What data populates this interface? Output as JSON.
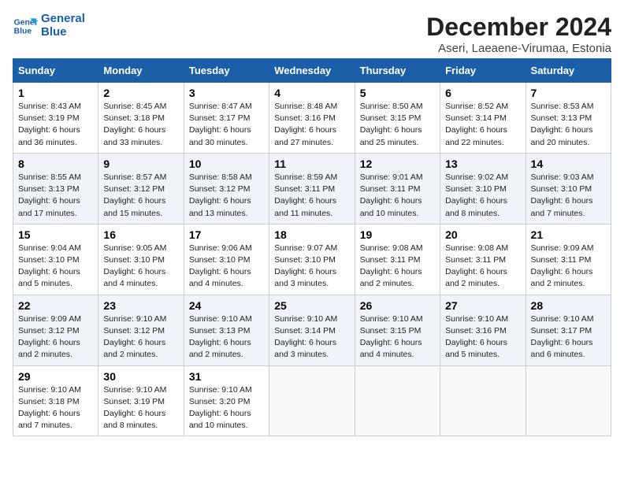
{
  "logo": {
    "line1": "General",
    "line2": "Blue"
  },
  "title": "December 2024",
  "subtitle": "Aseri, Laeaene-Virumaa, Estonia",
  "days_of_week": [
    "Sunday",
    "Monday",
    "Tuesday",
    "Wednesday",
    "Thursday",
    "Friday",
    "Saturday"
  ],
  "weeks": [
    [
      {
        "day": "1",
        "sunrise": "Sunrise: 8:43 AM",
        "sunset": "Sunset: 3:19 PM",
        "daylight": "Daylight: 6 hours and 36 minutes."
      },
      {
        "day": "2",
        "sunrise": "Sunrise: 8:45 AM",
        "sunset": "Sunset: 3:18 PM",
        "daylight": "Daylight: 6 hours and 33 minutes."
      },
      {
        "day": "3",
        "sunrise": "Sunrise: 8:47 AM",
        "sunset": "Sunset: 3:17 PM",
        "daylight": "Daylight: 6 hours and 30 minutes."
      },
      {
        "day": "4",
        "sunrise": "Sunrise: 8:48 AM",
        "sunset": "Sunset: 3:16 PM",
        "daylight": "Daylight: 6 hours and 27 minutes."
      },
      {
        "day": "5",
        "sunrise": "Sunrise: 8:50 AM",
        "sunset": "Sunset: 3:15 PM",
        "daylight": "Daylight: 6 hours and 25 minutes."
      },
      {
        "day": "6",
        "sunrise": "Sunrise: 8:52 AM",
        "sunset": "Sunset: 3:14 PM",
        "daylight": "Daylight: 6 hours and 22 minutes."
      },
      {
        "day": "7",
        "sunrise": "Sunrise: 8:53 AM",
        "sunset": "Sunset: 3:13 PM",
        "daylight": "Daylight: 6 hours and 20 minutes."
      }
    ],
    [
      {
        "day": "8",
        "sunrise": "Sunrise: 8:55 AM",
        "sunset": "Sunset: 3:13 PM",
        "daylight": "Daylight: 6 hours and 17 minutes."
      },
      {
        "day": "9",
        "sunrise": "Sunrise: 8:57 AM",
        "sunset": "Sunset: 3:12 PM",
        "daylight": "Daylight: 6 hours and 15 minutes."
      },
      {
        "day": "10",
        "sunrise": "Sunrise: 8:58 AM",
        "sunset": "Sunset: 3:12 PM",
        "daylight": "Daylight: 6 hours and 13 minutes."
      },
      {
        "day": "11",
        "sunrise": "Sunrise: 8:59 AM",
        "sunset": "Sunset: 3:11 PM",
        "daylight": "Daylight: 6 hours and 11 minutes."
      },
      {
        "day": "12",
        "sunrise": "Sunrise: 9:01 AM",
        "sunset": "Sunset: 3:11 PM",
        "daylight": "Daylight: 6 hours and 10 minutes."
      },
      {
        "day": "13",
        "sunrise": "Sunrise: 9:02 AM",
        "sunset": "Sunset: 3:10 PM",
        "daylight": "Daylight: 6 hours and 8 minutes."
      },
      {
        "day": "14",
        "sunrise": "Sunrise: 9:03 AM",
        "sunset": "Sunset: 3:10 PM",
        "daylight": "Daylight: 6 hours and 7 minutes."
      }
    ],
    [
      {
        "day": "15",
        "sunrise": "Sunrise: 9:04 AM",
        "sunset": "Sunset: 3:10 PM",
        "daylight": "Daylight: 6 hours and 5 minutes."
      },
      {
        "day": "16",
        "sunrise": "Sunrise: 9:05 AM",
        "sunset": "Sunset: 3:10 PM",
        "daylight": "Daylight: 6 hours and 4 minutes."
      },
      {
        "day": "17",
        "sunrise": "Sunrise: 9:06 AM",
        "sunset": "Sunset: 3:10 PM",
        "daylight": "Daylight: 6 hours and 4 minutes."
      },
      {
        "day": "18",
        "sunrise": "Sunrise: 9:07 AM",
        "sunset": "Sunset: 3:10 PM",
        "daylight": "Daylight: 6 hours and 3 minutes."
      },
      {
        "day": "19",
        "sunrise": "Sunrise: 9:08 AM",
        "sunset": "Sunset: 3:11 PM",
        "daylight": "Daylight: 6 hours and 2 minutes."
      },
      {
        "day": "20",
        "sunrise": "Sunrise: 9:08 AM",
        "sunset": "Sunset: 3:11 PM",
        "daylight": "Daylight: 6 hours and 2 minutes."
      },
      {
        "day": "21",
        "sunrise": "Sunrise: 9:09 AM",
        "sunset": "Sunset: 3:11 PM",
        "daylight": "Daylight: 6 hours and 2 minutes."
      }
    ],
    [
      {
        "day": "22",
        "sunrise": "Sunrise: 9:09 AM",
        "sunset": "Sunset: 3:12 PM",
        "daylight": "Daylight: 6 hours and 2 minutes."
      },
      {
        "day": "23",
        "sunrise": "Sunrise: 9:10 AM",
        "sunset": "Sunset: 3:12 PM",
        "daylight": "Daylight: 6 hours and 2 minutes."
      },
      {
        "day": "24",
        "sunrise": "Sunrise: 9:10 AM",
        "sunset": "Sunset: 3:13 PM",
        "daylight": "Daylight: 6 hours and 2 minutes."
      },
      {
        "day": "25",
        "sunrise": "Sunrise: 9:10 AM",
        "sunset": "Sunset: 3:14 PM",
        "daylight": "Daylight: 6 hours and 3 minutes."
      },
      {
        "day": "26",
        "sunrise": "Sunrise: 9:10 AM",
        "sunset": "Sunset: 3:15 PM",
        "daylight": "Daylight: 6 hours and 4 minutes."
      },
      {
        "day": "27",
        "sunrise": "Sunrise: 9:10 AM",
        "sunset": "Sunset: 3:16 PM",
        "daylight": "Daylight: 6 hours and 5 minutes."
      },
      {
        "day": "28",
        "sunrise": "Sunrise: 9:10 AM",
        "sunset": "Sunset: 3:17 PM",
        "daylight": "Daylight: 6 hours and 6 minutes."
      }
    ],
    [
      {
        "day": "29",
        "sunrise": "Sunrise: 9:10 AM",
        "sunset": "Sunset: 3:18 PM",
        "daylight": "Daylight: 6 hours and 7 minutes."
      },
      {
        "day": "30",
        "sunrise": "Sunrise: 9:10 AM",
        "sunset": "Sunset: 3:19 PM",
        "daylight": "Daylight: 6 hours and 8 minutes."
      },
      {
        "day": "31",
        "sunrise": "Sunrise: 9:10 AM",
        "sunset": "Sunset: 3:20 PM",
        "daylight": "Daylight: 6 hours and 10 minutes."
      },
      null,
      null,
      null,
      null
    ]
  ]
}
